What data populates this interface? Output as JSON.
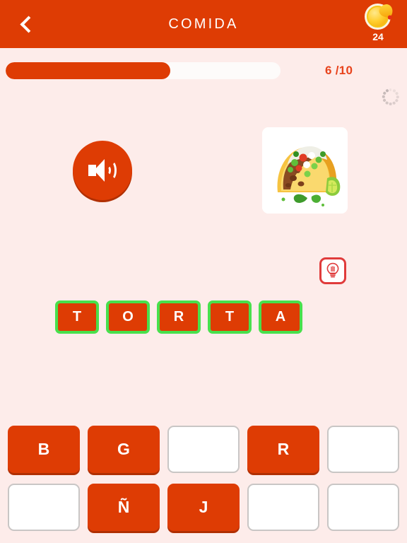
{
  "header": {
    "back_icon": "chevron-left-icon",
    "title": "COMIDA",
    "coin_icon": "coin-icon",
    "coin_count": "24"
  },
  "progress": {
    "label": "6 /10",
    "percent": 60,
    "spinner_icon": "loading-spinner-icon"
  },
  "prompt": {
    "audio_icon": "speaker-icon",
    "image_icon": "taco-image",
    "hint_icon": "lightbulb-icon"
  },
  "answer": {
    "tiles": [
      {
        "letter": "T"
      },
      {
        "letter": "O"
      },
      {
        "letter": "R"
      },
      {
        "letter": "T"
      },
      {
        "letter": "A"
      }
    ]
  },
  "keyboard": {
    "rows": [
      [
        {
          "letter": "B",
          "state": "filled"
        },
        {
          "letter": "G",
          "state": "filled"
        },
        {
          "letter": "",
          "state": "empty"
        },
        {
          "letter": "R",
          "state": "filled"
        },
        {
          "letter": "",
          "state": "empty"
        }
      ],
      [
        {
          "letter": "",
          "state": "empty"
        },
        {
          "letter": "Ñ",
          "state": "filled"
        },
        {
          "letter": "J",
          "state": "filled"
        },
        {
          "letter": "",
          "state": "empty"
        },
        {
          "letter": "",
          "state": "empty"
        }
      ]
    ]
  },
  "colors": {
    "brand_orange": "#DE3C04",
    "background_pink": "#FDECEA",
    "tile_border_green": "#48E04C",
    "hint_red": "#E03B3B",
    "coin_gold": "#FFCE2E"
  }
}
